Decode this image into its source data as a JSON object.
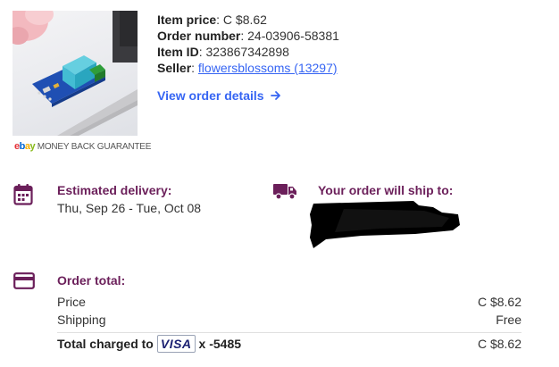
{
  "product": {
    "image_alt": "ZMPT101B voltage transformer module",
    "mbg_logo": {
      "e": "e",
      "b": "b",
      "a": "a",
      "y": "y"
    },
    "mbg_text": "MONEY BACK GUARANTEE"
  },
  "order_info": {
    "item_price_label": "Item price",
    "item_price": "C $8.62",
    "order_number_label": "Order number",
    "order_number": "24-03906-58381",
    "item_id_label": "Item ID",
    "item_id": "323867342898",
    "seller_label": "Seller",
    "seller": "flowersblossoms (13297)",
    "view_order_details": "View order details"
  },
  "delivery": {
    "heading": "Estimated delivery:",
    "range": "Thu, Sep 26 - Tue, Oct 08"
  },
  "shipping": {
    "heading": "Your order will ship to:"
  },
  "order_total": {
    "heading": "Order total:",
    "price_label": "Price",
    "price_value": "C $8.62",
    "shipping_label": "Shipping",
    "shipping_value": "Free",
    "charged_label": "Total charged to",
    "card_brand": "VISA",
    "card_suffix": "x -5485",
    "charged_value": "C $8.62"
  },
  "colors": {
    "accent": "#6b1f5a",
    "link": "#3665f3",
    "visa": "#1a1f71"
  },
  "icons": [
    "calendar-icon",
    "truck-icon",
    "credit-card-icon",
    "arrow-right-icon"
  ]
}
